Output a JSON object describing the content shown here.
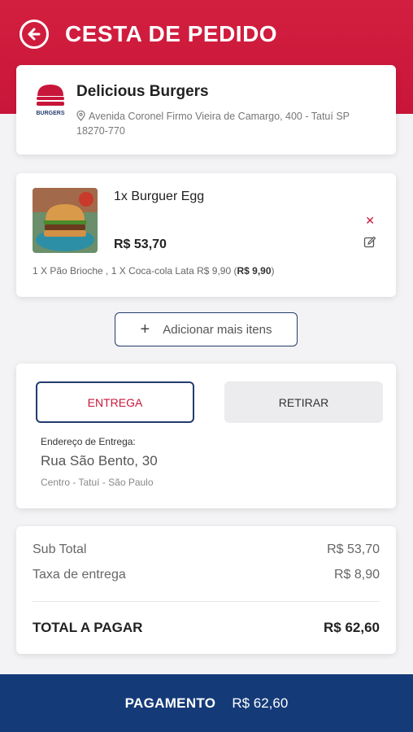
{
  "header": {
    "title": "CESTA DE PEDIDO",
    "back_icon": "arrow-left-circle-icon",
    "color": "#d31f3f"
  },
  "store": {
    "name": "Delicious Burgers",
    "address": "Avenida Coronel Firmo Vieira de Camargo, 400 - Tatuí SP 18270-770",
    "logo_text": "BURGERS"
  },
  "item": {
    "title": "1x Burguer Egg",
    "price": "R$ 53,70",
    "extras_text": "1 X Pão Brioche , 1 X Coca-cola Lata R$ 9,90 (",
    "extras_total": "R$ 9,90",
    "extras_close": ")",
    "remove_icon": "close-icon",
    "edit_icon": "edit-icon"
  },
  "add_more": {
    "label": "Adicionar mais itens"
  },
  "delivery": {
    "tab_delivery": "ENTREGA",
    "tab_pickup": "RETIRAR",
    "address_label": "Endereço de Entrega:",
    "street": "Rua São Bento, 30",
    "city": "Centro - Tatuí - São Paulo"
  },
  "totals": {
    "subtotal_label": "Sub Total",
    "subtotal_value": "R$ 53,70",
    "fee_label": "Taxa de entrega",
    "fee_value": "R$ 8,90",
    "total_label": "TOTAL A PAGAR",
    "total_value": "R$ 62,60"
  },
  "payment": {
    "label": "PAGAMENTO",
    "amount": "R$ 62,60",
    "color": "#143a78"
  },
  "colors": {
    "accent_red": "#c8163a",
    "navy": "#233b6e"
  }
}
